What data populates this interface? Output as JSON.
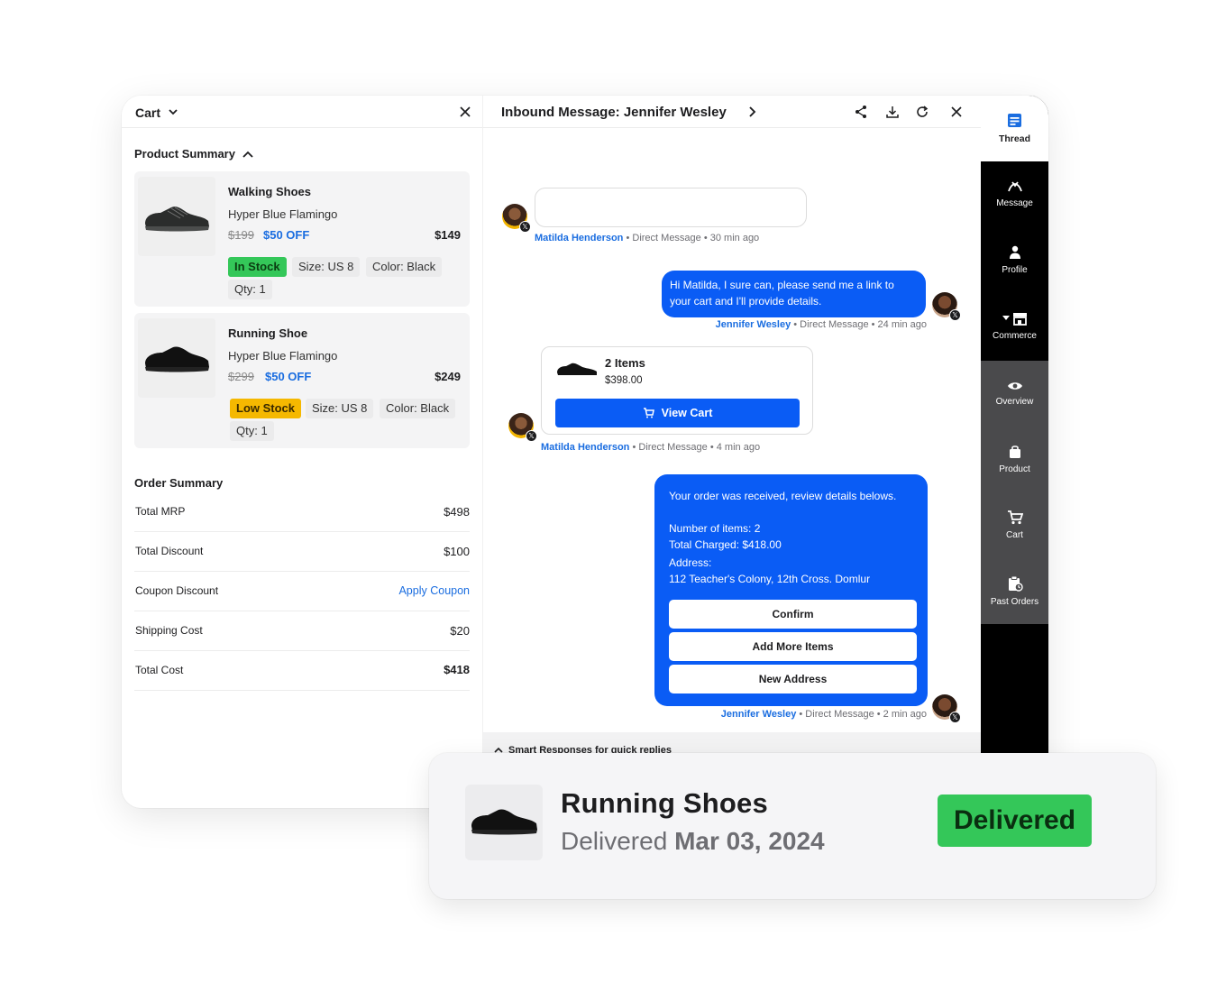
{
  "cart": {
    "title": "Cart",
    "product_summary_title": "Product Summary",
    "products": [
      {
        "name": "Walking Shoes",
        "variant": "Hyper Blue Flamingo",
        "original_price": "$199",
        "discount": "$50 OFF",
        "price": "$149",
        "stock": "In Stock",
        "size": "Size: US 8",
        "color": "Color: Black",
        "qty": "Qty: 1"
      },
      {
        "name": "Running Shoe",
        "variant": "Hyper Blue Flamingo",
        "original_price": "$299",
        "discount": "$50 OFF",
        "price": "$249",
        "stock": "Low Stock",
        "size": "Size: US 8",
        "color": "Color: Black",
        "qty": "Qty: 1"
      }
    ],
    "order_summary_title": "Order Summary",
    "order_summary": [
      {
        "label": "Total MRP",
        "value": "$498"
      },
      {
        "label": "Total Discount",
        "value": "$100"
      },
      {
        "label": "Coupon Discount",
        "value": "Apply Coupon"
      },
      {
        "label": "Shipping Cost",
        "value": "$20"
      },
      {
        "label": "Total Cost",
        "value": "$418"
      }
    ]
  },
  "thread": {
    "title": "Inbound Message: Jennifer Wesley",
    "messages": [
      {
        "author": "Matilda Henderson",
        "meta": " • Direct Message • 30 min ago"
      },
      {
        "author": "Jennifer Wesley",
        "meta": " • Direct Message • 24 min ago",
        "text": "Hi Matilda, I sure can, please send me a link to your cart and I'll provide details."
      },
      {
        "author": "Matilda Henderson",
        "meta": " • Direct Message • 4 min ago",
        "cart_items": "2 Items",
        "cart_total": "$398.00",
        "cart_button": "View Cart"
      },
      {
        "author": "Jennifer Wesley",
        "meta": " • Direct Message • 2 min ago",
        "line1": "Your order was received, review details belows.",
        "line2": "Number of items: 2",
        "line3": "Total Charged: $418.00",
        "line4": "Address:",
        "line5": "112 Teacher's Colony, 12th Cross. Domlur",
        "buttons": [
          "Confirm",
          "Add More Items",
          "New Address"
        ]
      }
    ],
    "smart_responses": "Smart Responses for quick replies"
  },
  "nav": {
    "items": [
      "Thread",
      "Message",
      "Profile",
      "Commerce",
      "Overview",
      "Product",
      "Cart",
      "Past Orders"
    ]
  },
  "delivered_card": {
    "title": "Running Shoes",
    "status_prefix": "Delivered ",
    "date": "Mar 03, 2024",
    "badge": "Delivered"
  },
  "colors": {
    "accent_blue": "#0a5cf5",
    "link_blue": "#1a6de0",
    "in_stock_green": "#34c759",
    "low_stock_yellow": "#f5b800",
    "nav_black": "#000000"
  }
}
